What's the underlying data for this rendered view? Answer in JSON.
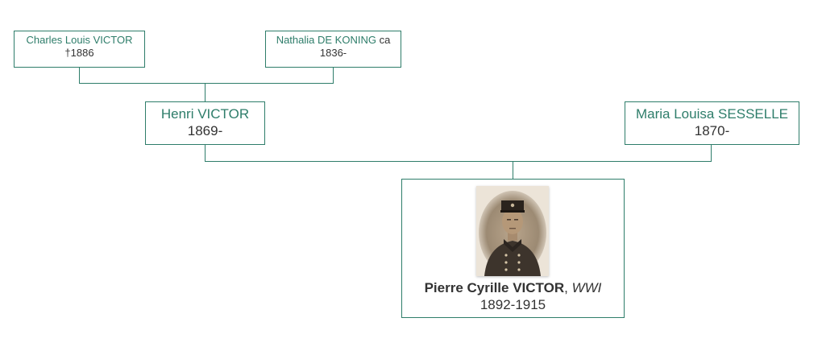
{
  "paternal_grandfather": {
    "name": "Charles Louis VICTOR",
    "dates": "†1886"
  },
  "paternal_grandmother": {
    "name": "Nathalia DE KONING",
    "name_suffix": " ca",
    "dates": "1836-"
  },
  "father": {
    "name": "Henri VICTOR",
    "dates": "1869-"
  },
  "mother": {
    "name": "Maria Louisa SESSELLE",
    "dates": "1870-"
  },
  "subject": {
    "name": "Pierre Cyrille VICTOR",
    "separator": ", ",
    "note": "WWI",
    "dates": "1892-1915"
  },
  "colors": {
    "accent": "#2e7d6a",
    "text": "#333333"
  }
}
